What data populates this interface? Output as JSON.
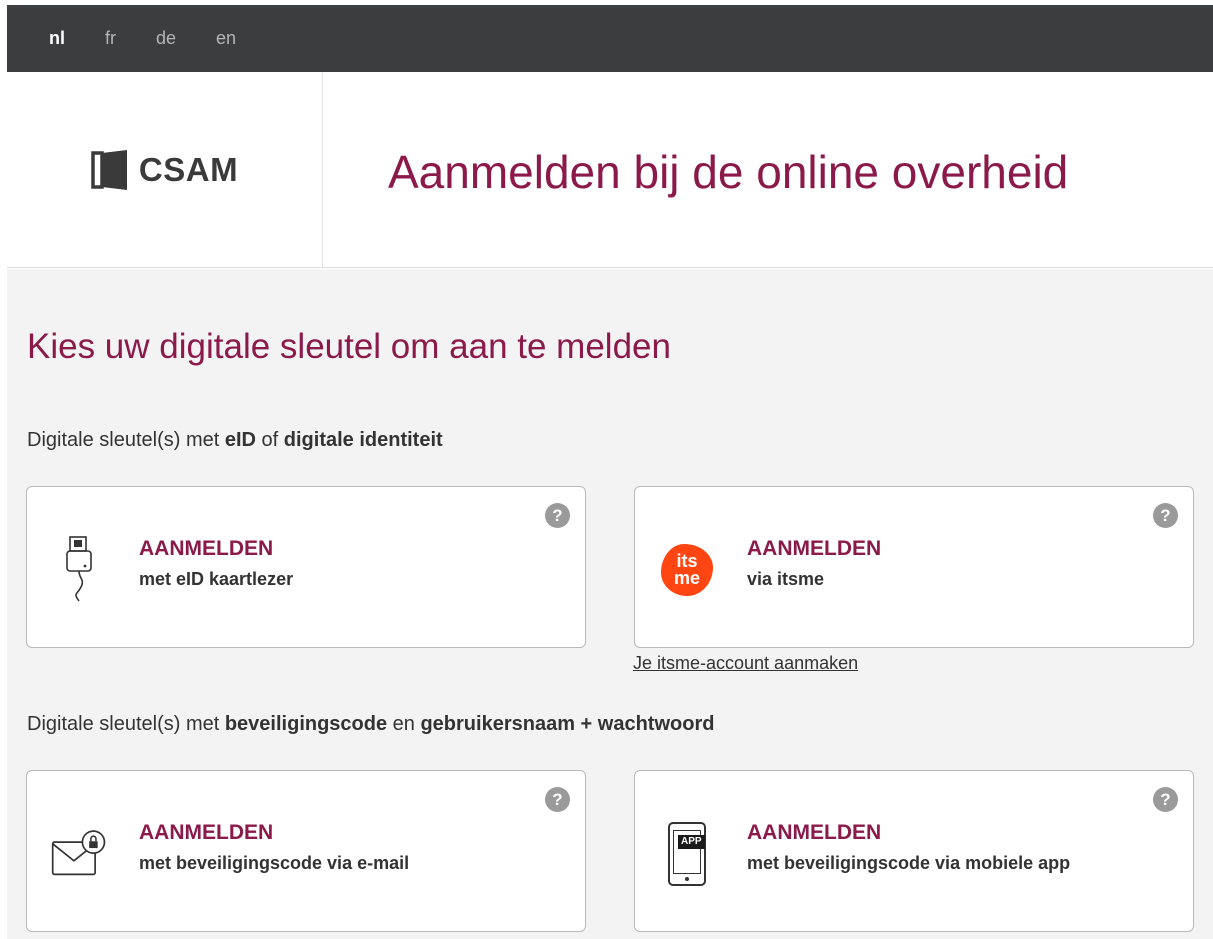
{
  "languages": [
    "nl",
    "fr",
    "de",
    "en"
  ],
  "active_language": "nl",
  "logo": {
    "text": "CSAM"
  },
  "header": {
    "title": "Aanmelden bij de online overheid"
  },
  "main": {
    "title": "Kies uw digitale sleutel om aan te melden",
    "group1": {
      "prefix": "Digitale sleutel(s) met ",
      "bold1": "eID",
      "mid": " of ",
      "bold2": "digitale identiteit"
    },
    "group2": {
      "prefix": "Digitale sleutel(s) met ",
      "bold1": "beveiligingscode",
      "mid": " en ",
      "bold2": "gebruikersnaam + wachtwoord"
    },
    "itsme_link": "Je itsme-account aanmaken",
    "help_glyph": "?",
    "cards": [
      {
        "title": "AANMELDEN",
        "subtitle": "met eID kaartlezer",
        "icon": "card-reader-icon"
      },
      {
        "title": "AANMELDEN",
        "subtitle": "via itsme",
        "icon": "itsme-logo-icon",
        "icon_text_top": "its",
        "icon_text_bottom": "me",
        "icon_color": "#ff4612"
      },
      {
        "title": "AANMELDEN",
        "subtitle": "met beveiligingscode via e-mail",
        "icon": "email-lock-icon"
      },
      {
        "title": "AANMELDEN",
        "subtitle": "met beveiligingscode via mobiele app",
        "icon": "mobile-app-icon",
        "icon_badge": "APP"
      }
    ]
  },
  "colors": {
    "accent": "#8b1a4a",
    "top_bar": "#3c3d3f",
    "main_bg": "#f3f3f3"
  }
}
